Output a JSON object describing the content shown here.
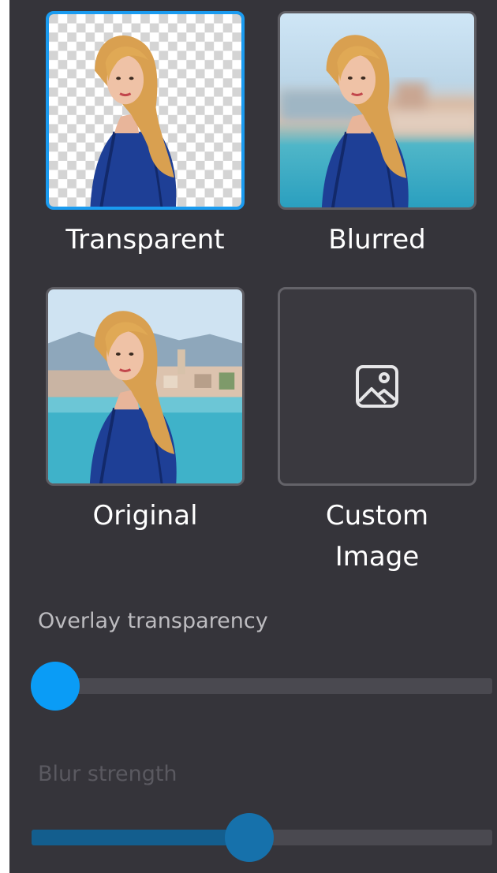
{
  "options": [
    {
      "label": "Transparent",
      "selected": true,
      "icon": "checkerboard-person"
    },
    {
      "label": "Blurred",
      "selected": false,
      "icon": "blurred-person"
    },
    {
      "label": "Original",
      "selected": false,
      "icon": "original-person"
    },
    {
      "label": "Custom\nImage",
      "selected": false,
      "icon": "image-icon"
    }
  ],
  "overlay": {
    "label": "Overlay transparency",
    "value": 0.0
  },
  "blur": {
    "label": "Blur strength",
    "value": 0.47
  },
  "colors": {
    "panel": "#35343a",
    "accent": "#1a9bf0",
    "dress": "#1e3f96",
    "hair": "#d9a050"
  }
}
